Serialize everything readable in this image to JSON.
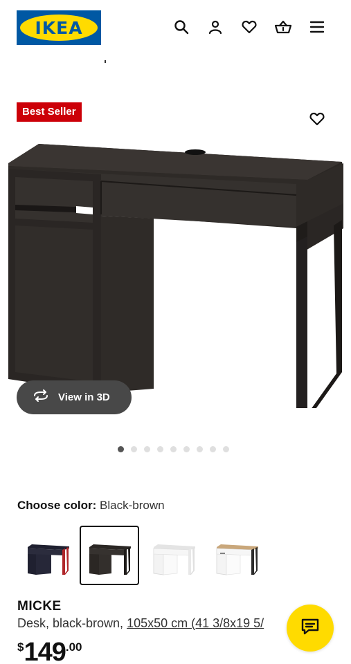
{
  "header": {
    "logo_text": "IKEA",
    "icons": [
      "search-icon",
      "user-icon",
      "heart-icon",
      "basket-icon",
      "menu-icon"
    ]
  },
  "product_image": {
    "badge": "Best Seller",
    "view_3d_label": "View in 3D",
    "carousel": {
      "total": 9,
      "active": 1
    }
  },
  "color_chooser": {
    "label": "Choose color:",
    "selected_value": "Black-brown",
    "swatch_count": 4,
    "selected_index": 2
  },
  "product": {
    "name": "MICKE",
    "description": "Desk, black-brown, ",
    "size_link": "105x50 cm (41 3/8x19 5/",
    "price_currency": "$",
    "price_integer": "149",
    "price_decimal": ".00"
  },
  "colors": {
    "ikea_blue": "#0058a3",
    "ikea_yellow": "#ffdb00",
    "badge_red": "#cc0008",
    "desk_dark": "#2b2724"
  }
}
